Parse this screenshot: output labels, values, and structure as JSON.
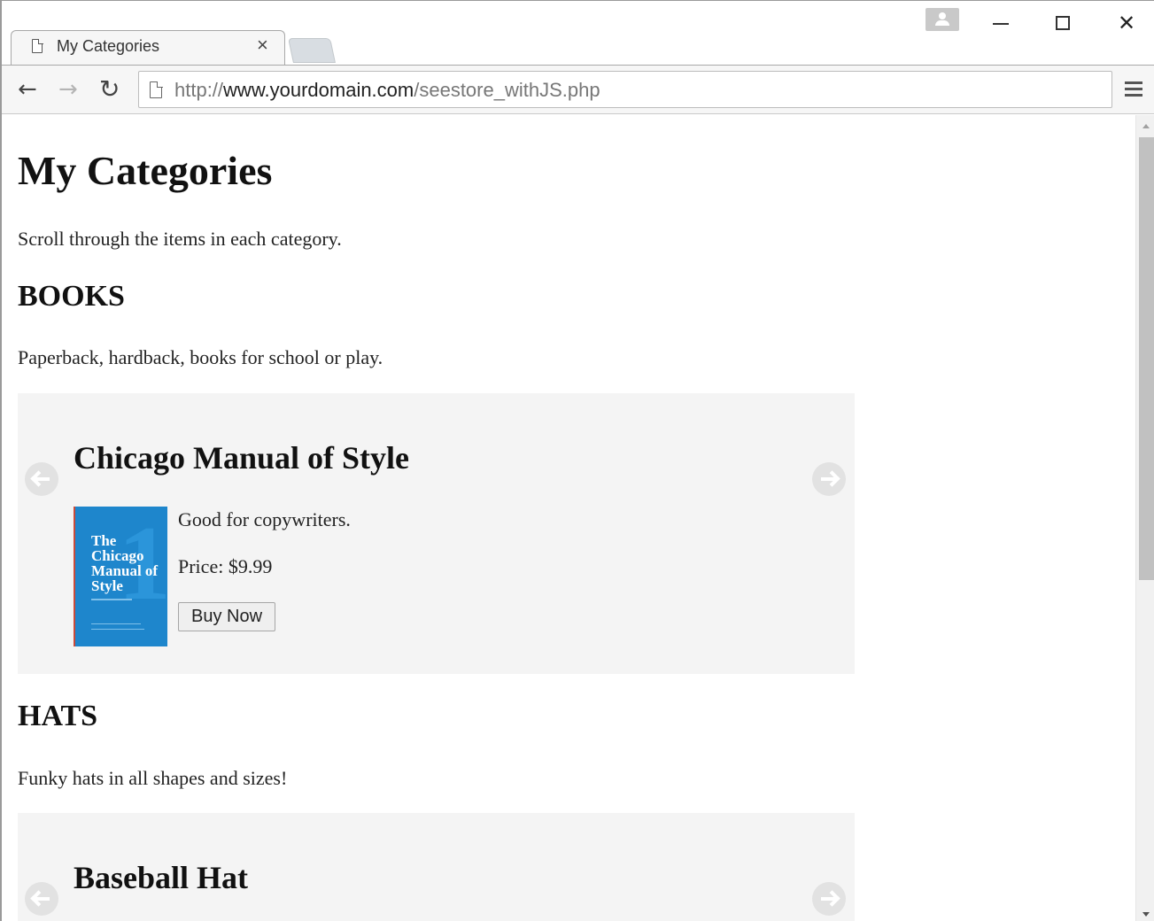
{
  "browser": {
    "tab_title": "My Categories",
    "tab_close": "×",
    "window_close": "✕",
    "url_scheme": "http://",
    "url_host": "www.yourdomain.com",
    "url_path": "/seestore_withJS.php",
    "back_glyph": "←",
    "forward_glyph": "→",
    "reload_glyph": "↻"
  },
  "page": {
    "title": "My Categories",
    "intro": "Scroll through the items in each category."
  },
  "categories": [
    {
      "heading": "BOOKS",
      "description": "Paperback, hardback, books for school or play.",
      "item": {
        "title": "Chicago Manual of Style",
        "cover_text": "The Chicago Manual of Style",
        "cover_number": "17",
        "description": "Good for copywriters.",
        "price": "Price: $9.99",
        "buy_label": "Buy Now"
      }
    },
    {
      "heading": "HATS",
      "description": "Funky hats in all shapes and sizes!",
      "item": {
        "title": "Baseball Hat"
      }
    }
  ],
  "icons": {
    "tab": "page-icon",
    "profile": "profile-icon",
    "menu": "hamburger-menu-icon",
    "carousel_prev": "arrow-left-circle-icon",
    "carousel_next": "arrow-right-circle-icon"
  }
}
